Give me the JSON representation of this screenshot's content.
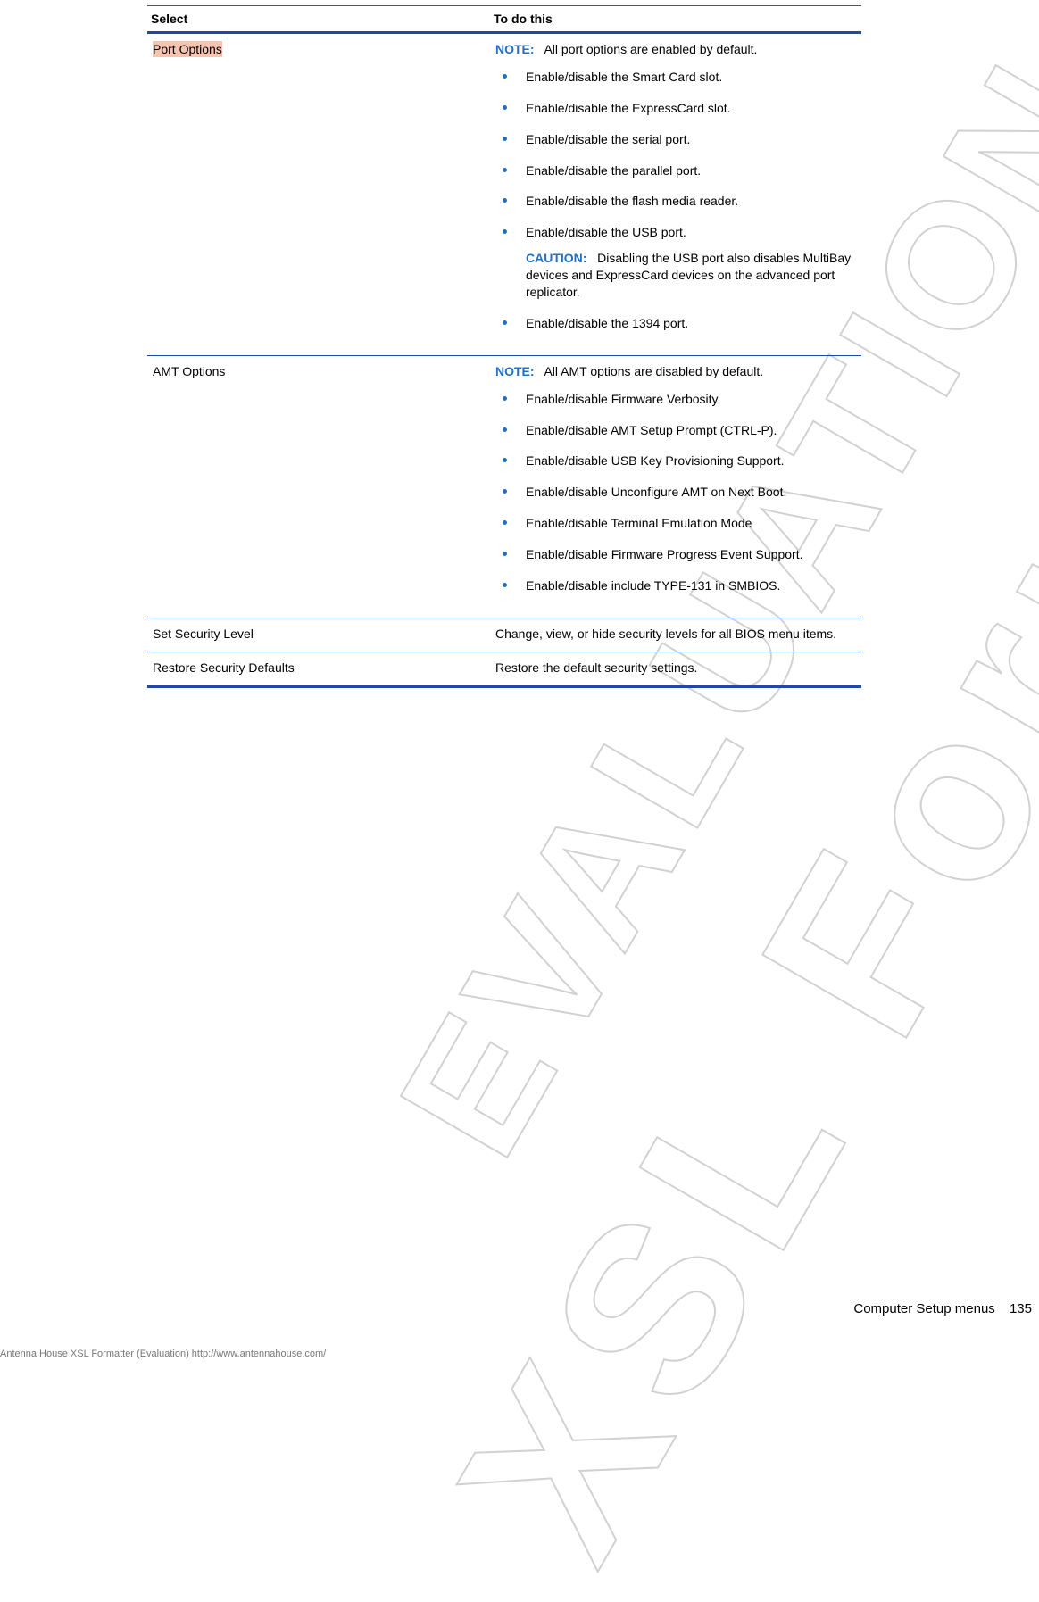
{
  "watermarks": {
    "line1": "XSL Formatter",
    "line2": "EVALUATION"
  },
  "table": {
    "head_select": "Select",
    "head_todo": "To do this",
    "rows": {
      "port": {
        "select": "Port Options",
        "note": "All port options are enabled by default.",
        "items": {
          "i1": "Enable/disable the Smart Card slot.",
          "i2": "Enable/disable the ExpressCard slot.",
          "i3": "Enable/disable the serial port.",
          "i4": "Enable/disable the parallel port.",
          "i5": "Enable/disable the flash media reader.",
          "i6": "Enable/disable the USB port.",
          "i6_caution": "Disabling the USB port also disables MultiBay devices and ExpressCard devices on the advanced port replicator.",
          "i7": "Enable/disable the 1394 port."
        }
      },
      "amt": {
        "select": "AMT Options",
        "note": "All AMT options are disabled by default.",
        "items": {
          "i1": "Enable/disable Firmware Verbosity.",
          "i2": "Enable/disable AMT Setup Prompt (CTRL-P).",
          "i3": "Enable/disable USB Key Provisioning Support.",
          "i4": "Enable/disable Unconfigure AMT on Next Boot.",
          "i5": "Enable/disable Terminal Emulation Mode",
          "i6": "Enable/disable Firmware Progress Event Support.",
          "i7": "Enable/disable include TYPE-131 in SMBIOS."
        }
      },
      "sec": {
        "select": "Set Security Level",
        "desc": "Change, view, or hide security levels for all BIOS menu items."
      },
      "restore": {
        "select": "Restore Security Defaults",
        "desc": "Restore the default security settings."
      }
    }
  },
  "labels": {
    "note": "NOTE:",
    "caution": "CAUTION:"
  },
  "footer": {
    "chapter": "Computer Setup menus",
    "pageno": "135",
    "eval": "Antenna House XSL Formatter (Evaluation)  http://www.antennahouse.com/"
  }
}
